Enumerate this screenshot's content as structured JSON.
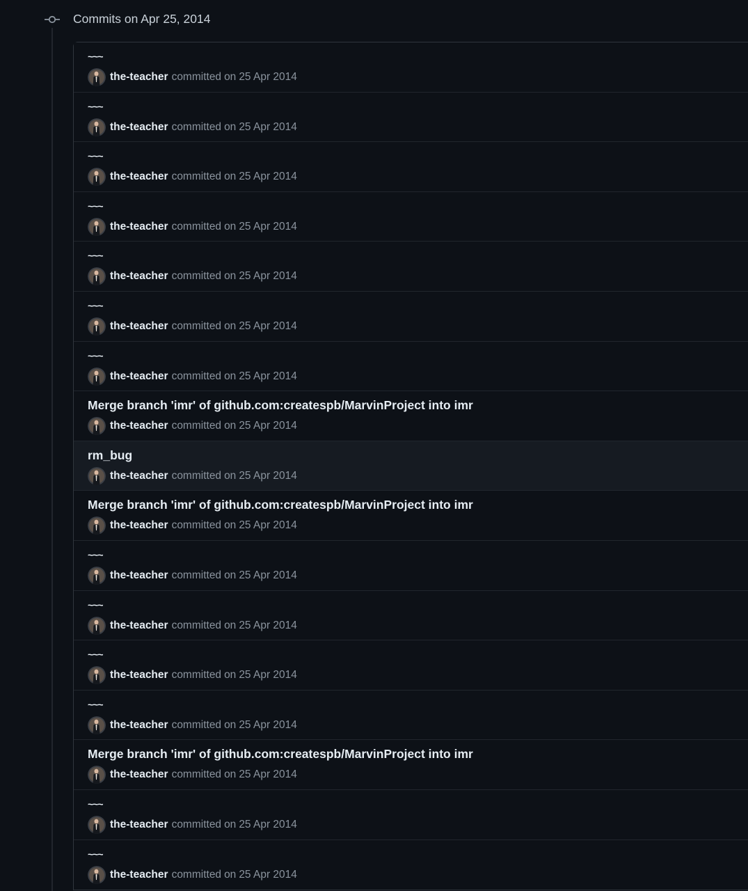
{
  "group": {
    "title": "Commits on Apr 25, 2014"
  },
  "commits": [
    {
      "message": "~~~",
      "author": "the-teacher",
      "action": "committed",
      "on": "on",
      "date": "25 Apr 2014"
    },
    {
      "message": "~~~",
      "author": "the-teacher",
      "action": "committed",
      "on": "on",
      "date": "25 Apr 2014"
    },
    {
      "message": "~~~",
      "author": "the-teacher",
      "action": "committed",
      "on": "on",
      "date": "25 Apr 2014"
    },
    {
      "message": "~~~",
      "author": "the-teacher",
      "action": "committed",
      "on": "on",
      "date": "25 Apr 2014"
    },
    {
      "message": "~~~",
      "author": "the-teacher",
      "action": "committed",
      "on": "on",
      "date": "25 Apr 2014"
    },
    {
      "message": "~~~",
      "author": "the-teacher",
      "action": "committed",
      "on": "on",
      "date": "25 Apr 2014"
    },
    {
      "message": "~~~",
      "author": "the-teacher",
      "action": "committed",
      "on": "on",
      "date": "25 Apr 2014"
    },
    {
      "message": "Merge branch 'imr' of github.com:createspb/MarvinProject into imr",
      "author": "the-teacher",
      "action": "committed",
      "on": "on",
      "date": "25 Apr 2014"
    },
    {
      "message": "rm_bug",
      "author": "the-teacher",
      "action": "committed",
      "on": "on",
      "date": "25 Apr 2014"
    },
    {
      "message": "Merge branch 'imr' of github.com:createspb/MarvinProject into imr",
      "author": "the-teacher",
      "action": "committed",
      "on": "on",
      "date": "25 Apr 2014"
    },
    {
      "message": "~~~",
      "author": "the-teacher",
      "action": "committed",
      "on": "on",
      "date": "25 Apr 2014"
    },
    {
      "message": "~~~",
      "author": "the-teacher",
      "action": "committed",
      "on": "on",
      "date": "25 Apr 2014"
    },
    {
      "message": "~~~",
      "author": "the-teacher",
      "action": "committed",
      "on": "on",
      "date": "25 Apr 2014"
    },
    {
      "message": "~~~",
      "author": "the-teacher",
      "action": "committed",
      "on": "on",
      "date": "25 Apr 2014"
    },
    {
      "message": "Merge branch 'imr' of github.com:createspb/MarvinProject into imr",
      "author": "the-teacher",
      "action": "committed",
      "on": "on",
      "date": "25 Apr 2014"
    },
    {
      "message": "~~~",
      "author": "the-teacher",
      "action": "committed",
      "on": "on",
      "date": "25 Apr 2014"
    },
    {
      "message": "~~~",
      "author": "the-teacher",
      "action": "committed",
      "on": "on",
      "date": "25 Apr 2014"
    }
  ],
  "colors": {
    "background": "#0d1117",
    "border": "#30363d",
    "row_hover": "#161b22",
    "text_primary": "#e6edf3",
    "text_muted": "#8b949e"
  },
  "icons": {
    "group_marker": "git-commit-icon",
    "avatar": "user-avatar"
  }
}
